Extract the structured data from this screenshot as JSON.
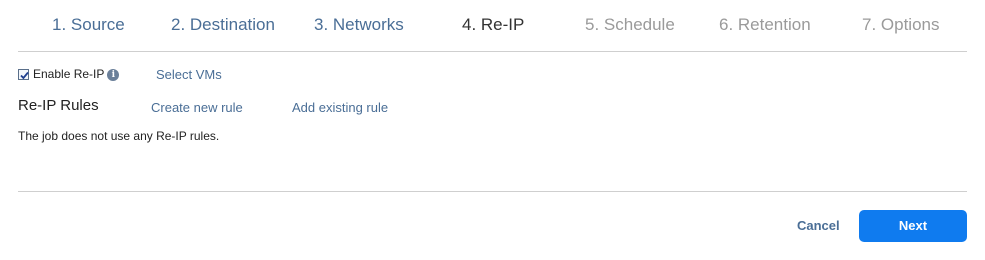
{
  "steps": [
    {
      "label": "1. Source",
      "state": "done"
    },
    {
      "label": "2. Destination",
      "state": "done"
    },
    {
      "label": "3. Networks",
      "state": "done"
    },
    {
      "label": "4. Re-IP",
      "state": "current"
    },
    {
      "label": "5. Schedule",
      "state": "upcoming"
    },
    {
      "label": "6. Retention",
      "state": "upcoming"
    },
    {
      "label": "7. Options",
      "state": "upcoming"
    }
  ],
  "reip": {
    "enable_label": "Enable Re-IP",
    "enable_checked": true,
    "info_glyph": "i",
    "select_vms": "Select VMs",
    "rules_title": "Re-IP Rules",
    "create_rule": "Create new rule",
    "add_existing_rule": "Add existing rule",
    "empty_message": "The job does not use any Re-IP rules."
  },
  "footer": {
    "cancel_label": "Cancel",
    "next_label": "Next"
  },
  "colors": {
    "link": "#4a6e96",
    "primary_button": "#0f7bef",
    "upcoming_step": "#9a9a9a",
    "divider": "#cfcfcf"
  },
  "icons": {
    "info": "info-icon",
    "check": "checkmark-icon"
  }
}
